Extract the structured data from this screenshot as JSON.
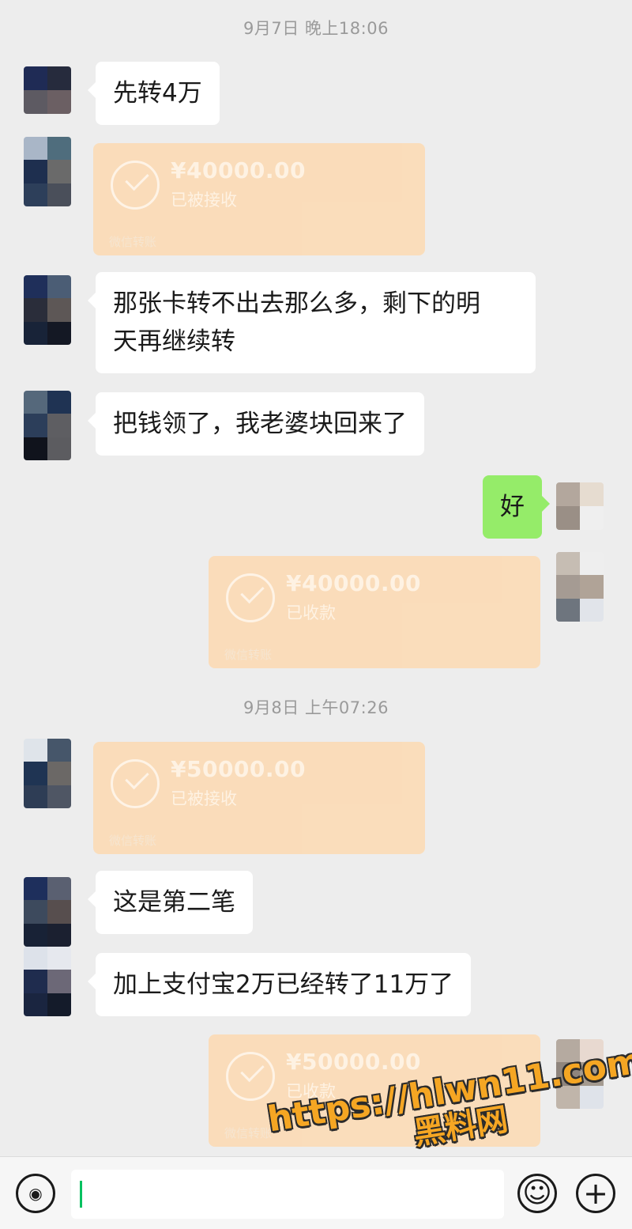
{
  "timestamps": [
    "9月7日 晚上18:06",
    "9月8日 上午07:26"
  ],
  "messages": {
    "m1": "先转4万",
    "t1": {
      "amount": "¥40000.00",
      "status": "已被接收",
      "footer": "微信转账"
    },
    "m2_line1": "那张卡转不出去那么多，剩下的明",
    "m2_line2": "天再继续转",
    "m3": "把钱领了，我老婆块回来了",
    "m4": "好",
    "t2": {
      "amount": "¥40000.00",
      "status": "已收款",
      "footer": "微信转账"
    },
    "t3": {
      "amount": "¥50000.00",
      "status": "已被接收",
      "footer": "微信转账"
    },
    "m5": "这是第二笔",
    "m6": "加上支付宝2万已经转了11万了",
    "t4": {
      "amount": "¥50000.00",
      "status": "已收款",
      "footer": "微信转账"
    }
  },
  "watermark": {
    "line1": "https://hlwn11.com",
    "line2": "黑料网"
  },
  "input_bar": {
    "voice_icon": "voice-icon",
    "emoji_icon": "emoji-icon",
    "plus_icon": "plus-icon",
    "emoji_glyph": "☺",
    "plus_glyph": "+",
    "voice_glyph": "◉"
  },
  "colors": {
    "background": "#ededed",
    "own_bubble": "#95ec69",
    "transfer_card": "#fbdcb8",
    "watermark": "#f5a623"
  }
}
